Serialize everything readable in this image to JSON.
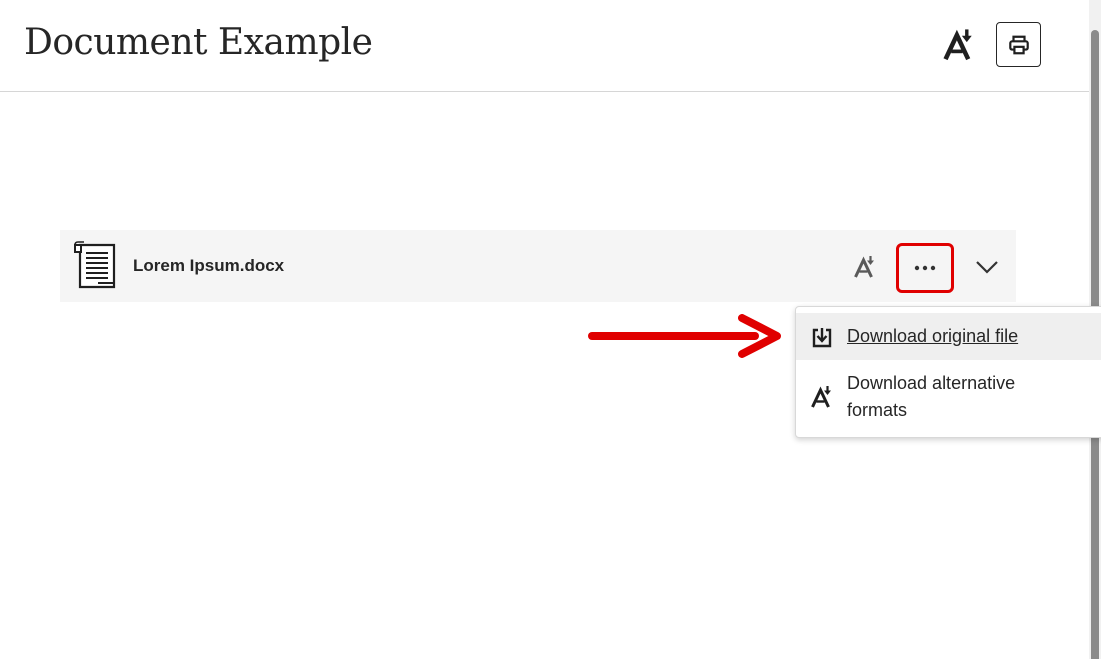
{
  "header": {
    "title": "Document Example",
    "alt_formats_icon": "alternative-formats-icon",
    "print_icon": "print-icon"
  },
  "file": {
    "name": "Lorem Ipsum.docx",
    "icon": "document-icon",
    "row_actions": [
      "alternative-formats-icon",
      "more-options-icon",
      "chevron-down-icon"
    ]
  },
  "menu": {
    "items": [
      {
        "label": "Download original file",
        "icon": "download-icon"
      },
      {
        "label": "Download alternative formats",
        "icon": "alternative-formats-icon"
      }
    ]
  },
  "colors": {
    "highlight": "#e00000",
    "row_background": "#f5f5f5",
    "menu_hover": "#efefef"
  }
}
